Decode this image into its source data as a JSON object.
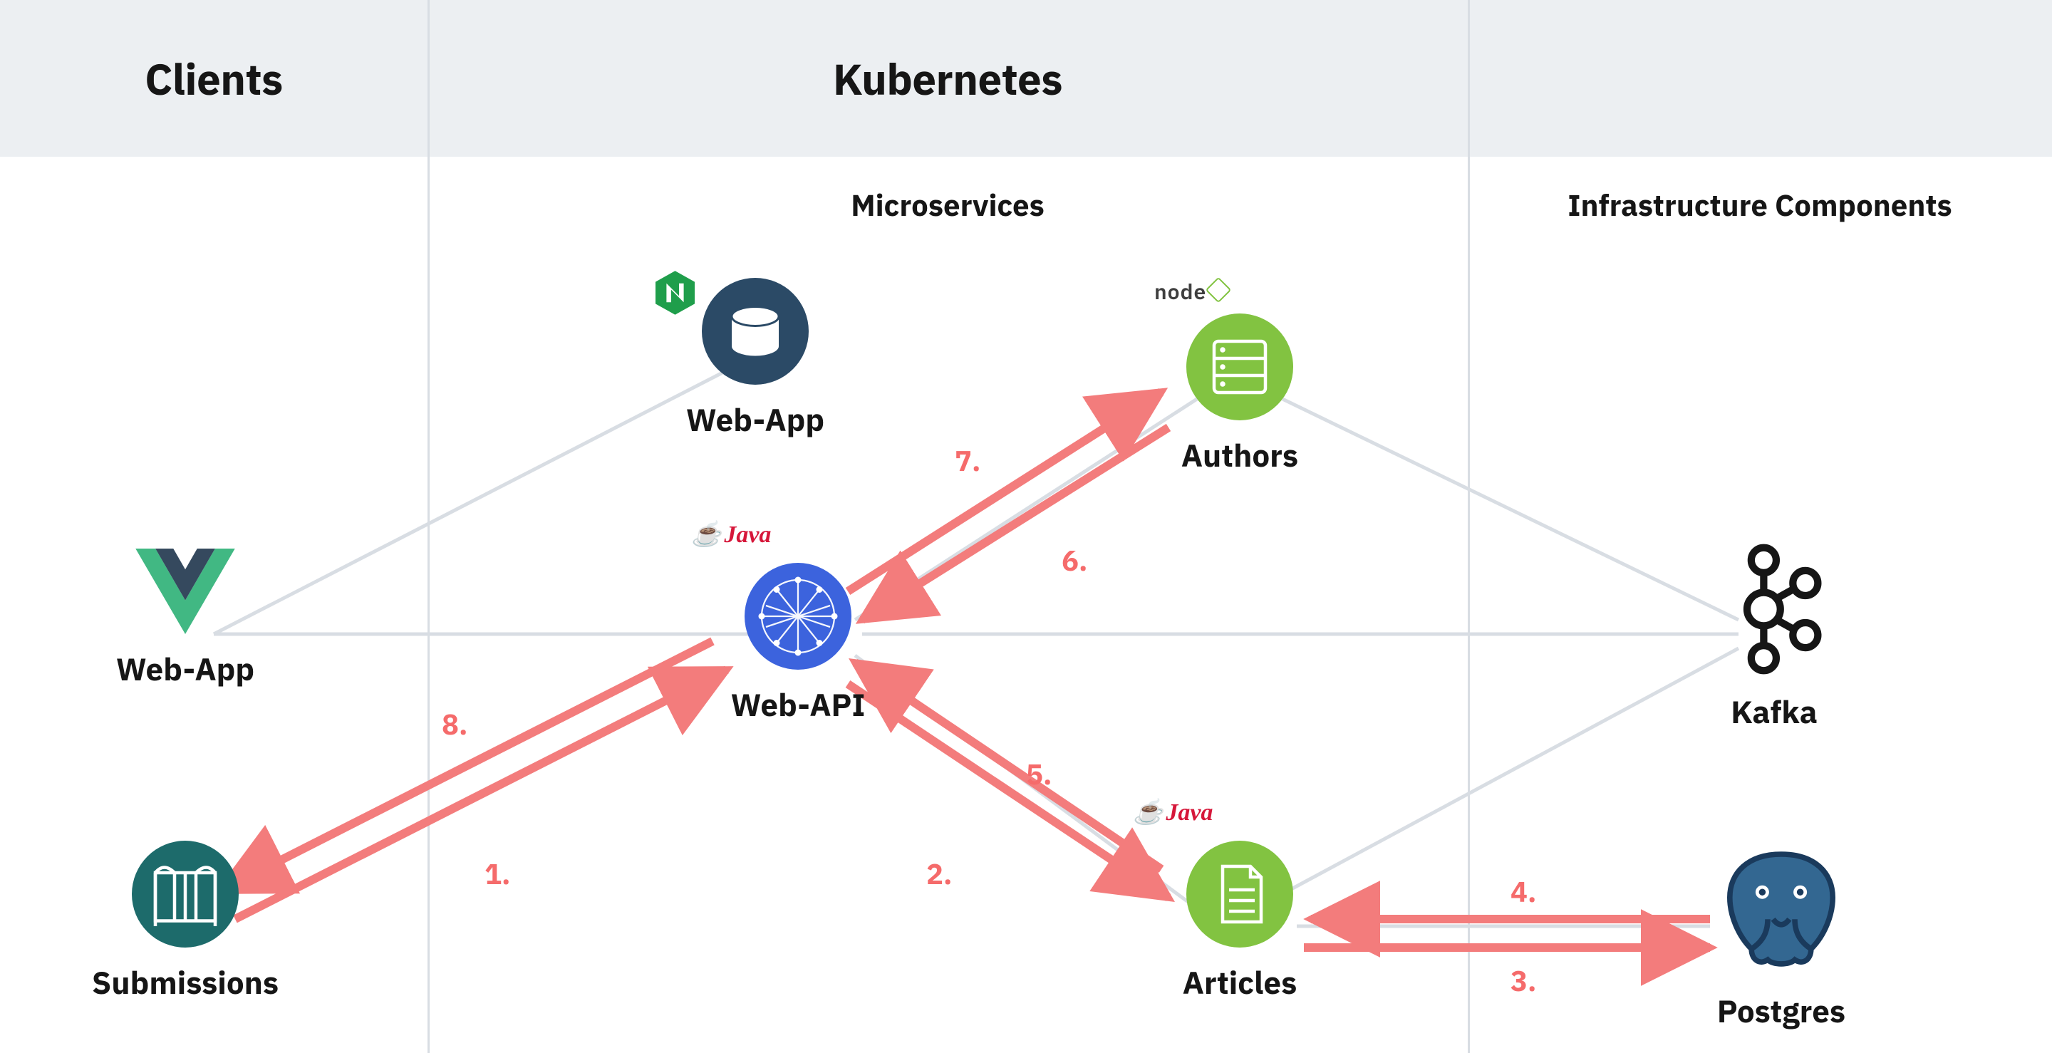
{
  "headers": {
    "col1": "Clients",
    "col2": "Kubernetes",
    "sub_ms": "Microservices",
    "sub_infra": "Infrastructure Components"
  },
  "nodes": {
    "client_webapp": "Web-App",
    "submissions": "Submissions",
    "ms_webapp": "Web-App",
    "web_api": "Web-API",
    "authors": "Authors",
    "articles": "Articles",
    "kafka": "Kafka",
    "postgres": "Postgres"
  },
  "badges": {
    "nginx": "N",
    "java_api": "Java",
    "java_articles": "Java",
    "node_authors": "node"
  },
  "steps": {
    "s1": "1.",
    "s2": "2.",
    "s3": "3.",
    "s4": "4.",
    "s5": "5.",
    "s6": "6.",
    "s7": "7.",
    "s8": "8."
  },
  "colors": {
    "arrow": "#f37c7c",
    "light_line": "#d8dde3",
    "blue": "#3c63dd",
    "teal": "#1d6b6b",
    "darkblue": "#2b4a66",
    "green": "#82c341",
    "nginx": "#1f9e4b",
    "pg": "#336791"
  }
}
